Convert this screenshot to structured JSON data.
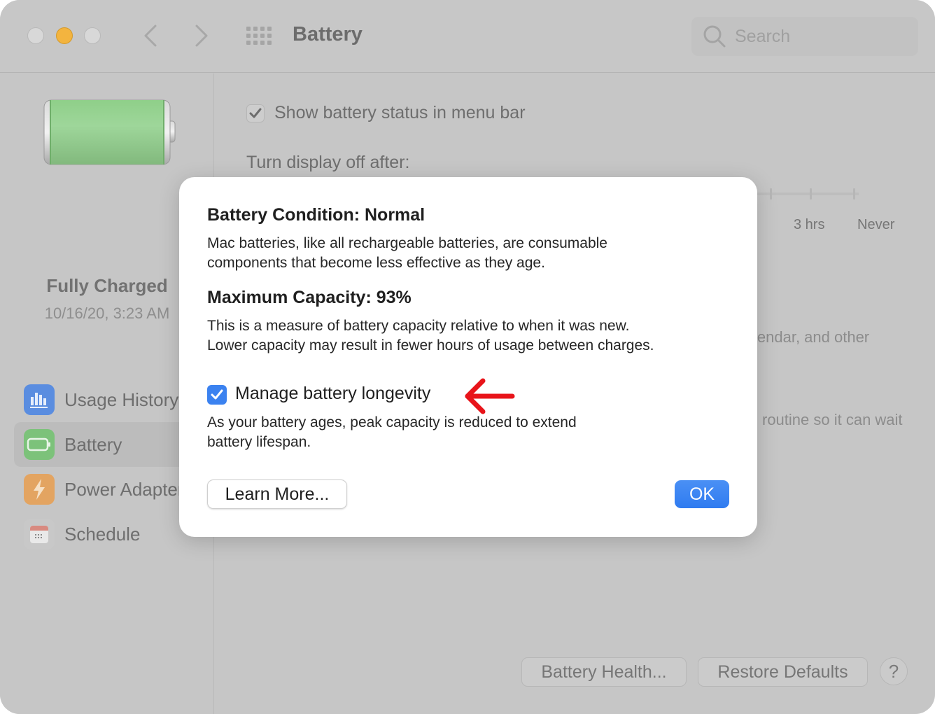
{
  "window": {
    "title": "Battery",
    "search_placeholder": "Search"
  },
  "sidebar": {
    "status_title": "Fully Charged",
    "status_time": "10/16/20, 3:23 AM",
    "items": [
      {
        "label": "Usage History",
        "icon": "bar-chart-icon",
        "color": "#5a8de0",
        "active": false
      },
      {
        "label": "Battery",
        "icon": "battery-icon",
        "color": "#7cc27a",
        "active": true
      },
      {
        "label": "Power Adapter",
        "icon": "lightning-icon",
        "color": "#e3a461",
        "active": false
      },
      {
        "label": "Schedule",
        "icon": "calendar-icon",
        "color": "#d8d8d8",
        "active": false
      }
    ]
  },
  "main": {
    "show_status_label": "Show battery status in menu bar",
    "show_status_checked": true,
    "display_off_label": "Turn display off after:",
    "slider_ticks": [
      "3 hrs",
      "Never"
    ],
    "partial_text_1": "lendar, and other",
    "partial_text_2": "routine so it can wait",
    "battery_health_button": "Battery Health...",
    "restore_defaults_button": "Restore Defaults",
    "help_button": "?"
  },
  "dialog": {
    "condition_heading": "Battery Condition: Normal",
    "condition_text_1": "Mac batteries, like all rechargeable batteries, are consumable",
    "condition_text_2": "components that become less effective as they age.",
    "capacity_heading": "Maximum Capacity: 93%",
    "capacity_value_percent": 93,
    "capacity_text_1": "This is a measure of battery capacity relative to when it was new.",
    "capacity_text_2": "Lower capacity may result in fewer hours of usage between charges.",
    "manage_label": "Manage battery longevity",
    "manage_checked": true,
    "manage_text_1": "As your battery ages, peak capacity is reduced to extend",
    "manage_text_2": "battery lifespan.",
    "learn_more_button": "Learn More...",
    "ok_button": "OK",
    "annotation_arrow_color": "#e8141a",
    "accent_color": "#3b82f0"
  }
}
